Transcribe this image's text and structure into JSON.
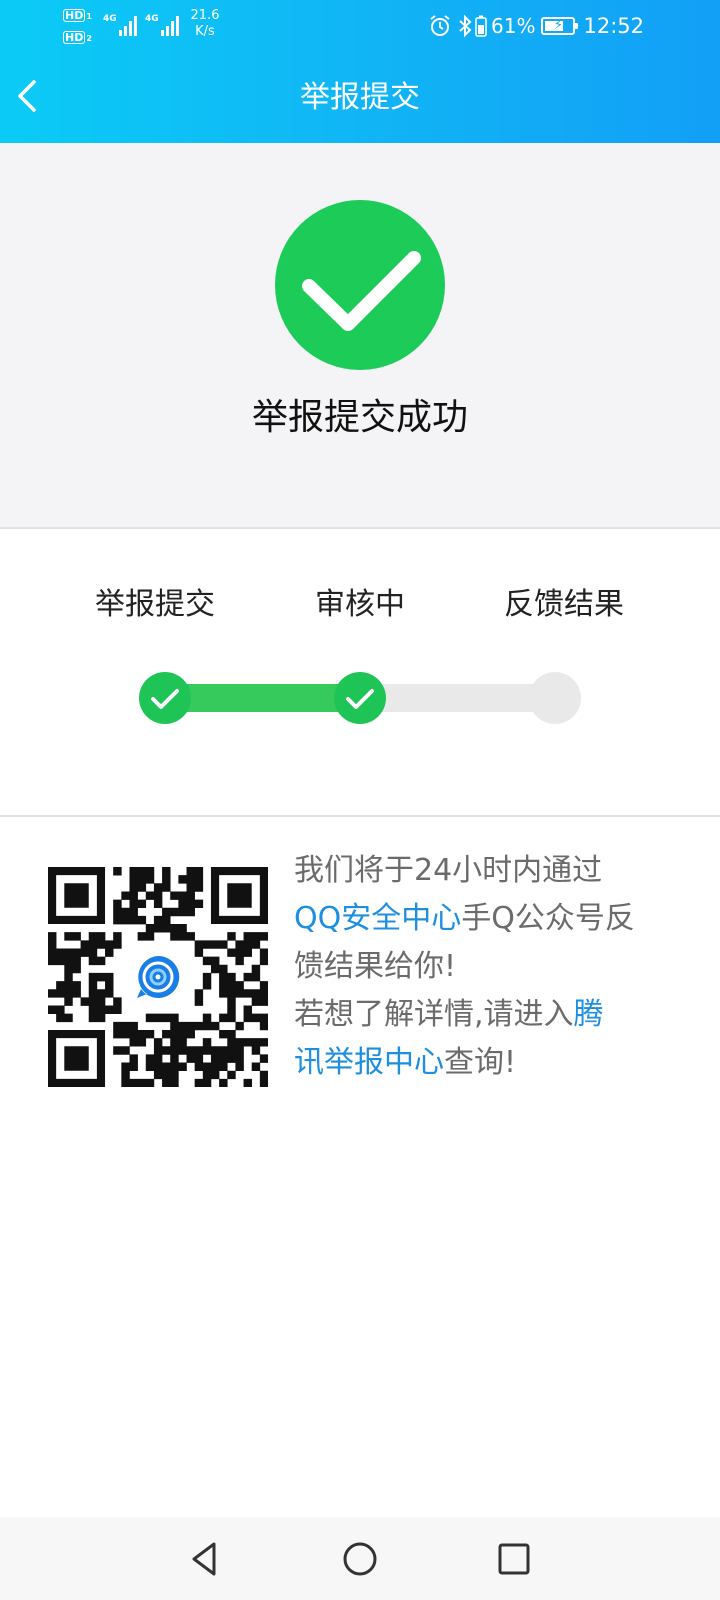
{
  "status_bar": {
    "hd1": "HD",
    "hd1_sim": "1",
    "hd2": "HD",
    "hd2_sim": "2",
    "network_type_1": "4G",
    "network_type_2": "4G",
    "speed_value": "21.6",
    "speed_unit": "K/s",
    "battery_percent": "61%",
    "time": "12:52",
    "icons": [
      "alarm-icon",
      "bluetooth-icon",
      "battery-icon",
      "charging-icon"
    ]
  },
  "header": {
    "title": "举报提交",
    "back_icon": "chevron-left-icon"
  },
  "success": {
    "icon": "check-circle-icon",
    "message": "举报提交成功",
    "color": "#1ccb58"
  },
  "progress": {
    "steps": [
      {
        "label": "举报提交",
        "state": "done"
      },
      {
        "label": "审核中",
        "state": "done"
      },
      {
        "label": "反馈结果",
        "state": "pending"
      }
    ],
    "active_color": "#36c95c",
    "inactive_color": "#e9e9e9"
  },
  "info": {
    "qr_code": "qr-code",
    "qr_logo": "qq-security-logo",
    "line1": "我们将于24小时内通过",
    "link1": "QQ安全中心",
    "line2": "手Q公众号反",
    "line3": "馈结果给你!",
    "line4": "若想了解详情,请进入",
    "link2a": "腾",
    "link2b": "讯举报中心",
    "line5": "查询!",
    "link_color": "#1e8fe0"
  },
  "nav_bar": {
    "items": [
      "back-triangle-icon",
      "home-circle-icon",
      "recents-square-icon"
    ]
  }
}
